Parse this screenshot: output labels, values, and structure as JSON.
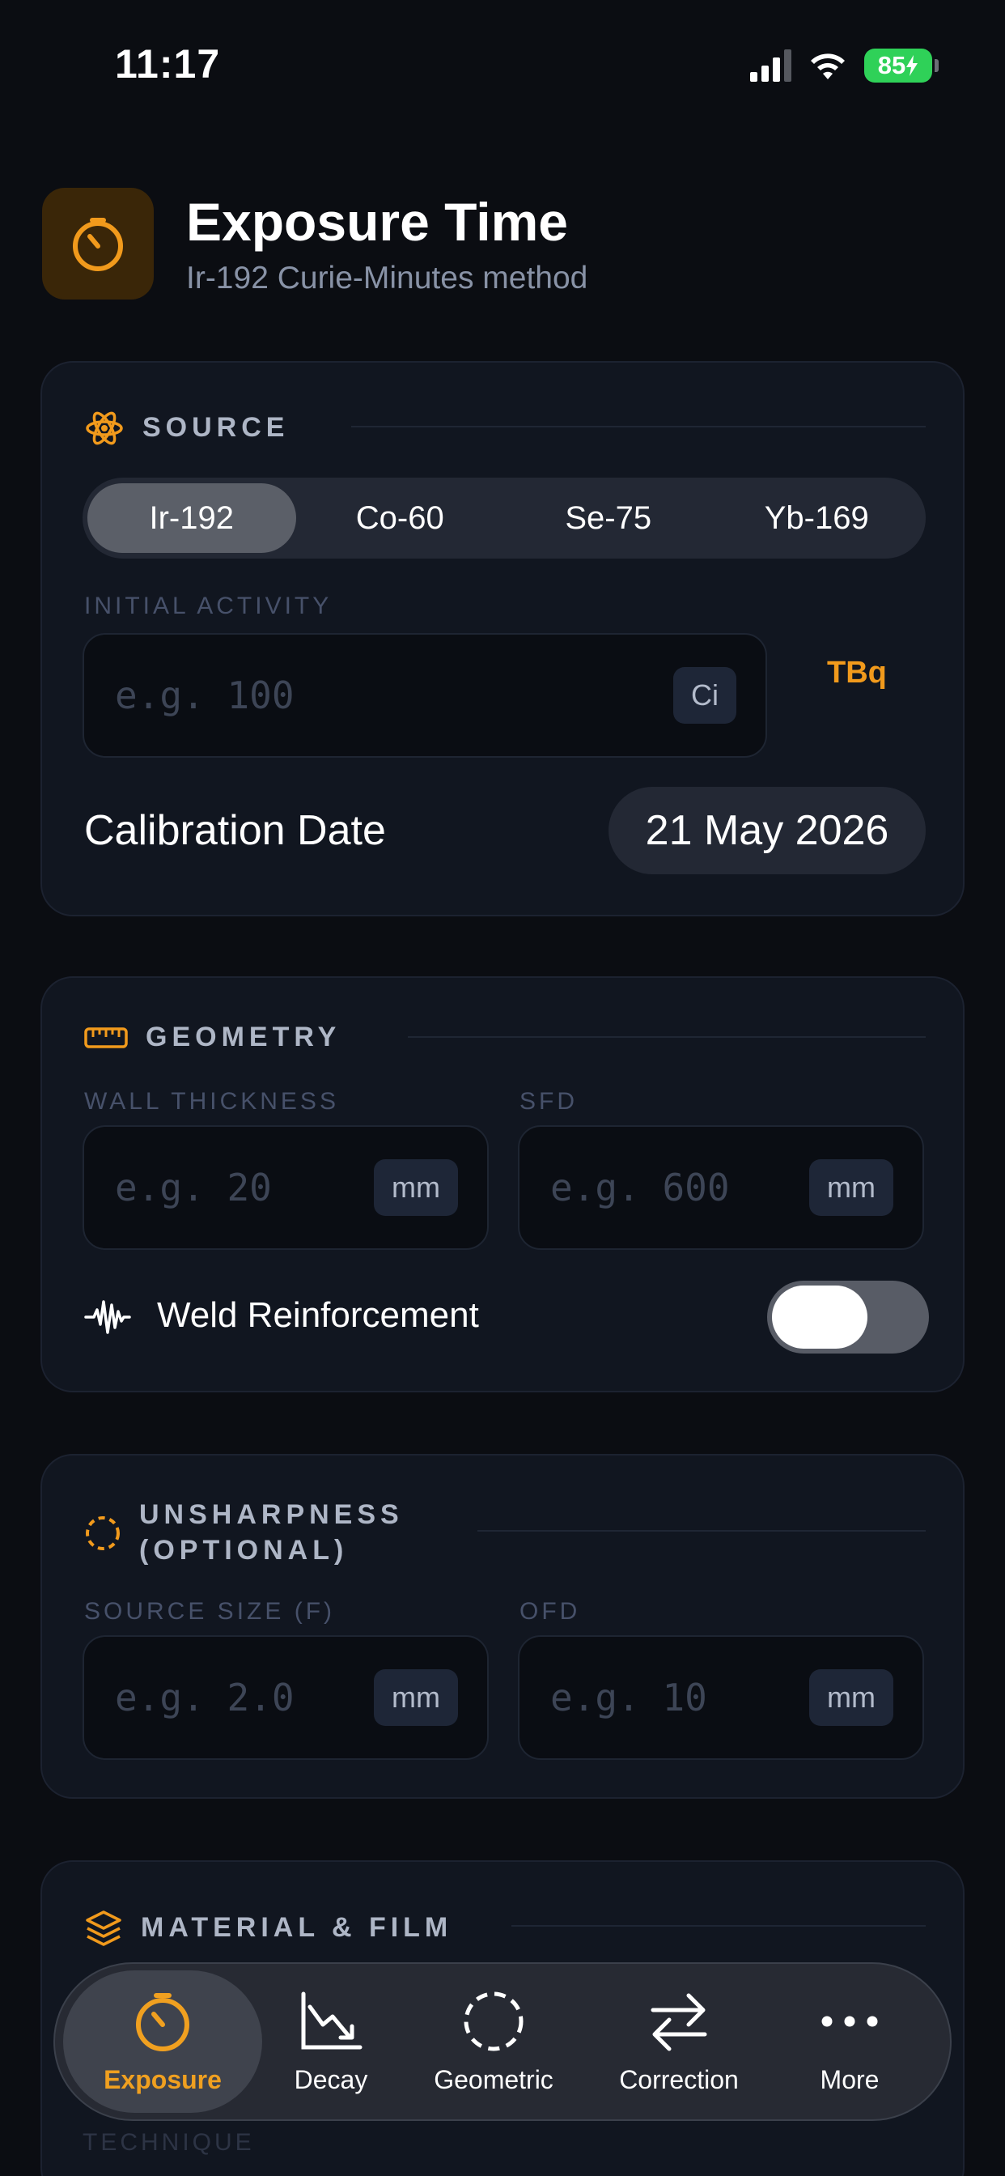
{
  "status_bar": {
    "time": "11:17",
    "battery": "85"
  },
  "header": {
    "title": "Exposure Time",
    "subtitle": "Ir-192 Curie-Minutes method"
  },
  "source": {
    "label": "SOURCE",
    "isotopes": [
      "Ir-192",
      "Co-60",
      "Se-75",
      "Yb-169"
    ],
    "selected": "Ir-192",
    "initial_activity_label": "INITIAL ACTIVITY",
    "initial_activity_placeholder": "e.g. 100",
    "unit": "Ci",
    "alt_unit": "TBq",
    "calibration_label": "Calibration Date",
    "calibration_date": "21 May 2026"
  },
  "geometry": {
    "label": "GEOMETRY",
    "wall_label": "WALL THICKNESS",
    "wall_placeholder": "e.g. 20",
    "wall_unit": "mm",
    "sfd_label": "SFD",
    "sfd_placeholder": "e.g. 600",
    "sfd_unit": "mm",
    "weld_label": "Weld Reinforcement",
    "weld_on": false
  },
  "unsharpness": {
    "label_line1": "UNSHARPNESS",
    "label_line2": "(OPTIONAL)",
    "source_size_label": "SOURCE SIZE (F)",
    "source_size_placeholder": "e.g. 2.0",
    "source_size_unit": "mm",
    "ofd_label": "OFD",
    "ofd_placeholder": "e.g. 10",
    "ofd_unit": "mm"
  },
  "material": {
    "label": "MATERIAL & FILM",
    "technique_label": "TECHNIQUE"
  },
  "tabbar": {
    "items": [
      {
        "label": "Exposure",
        "icon": "timer-icon"
      },
      {
        "label": "Decay",
        "icon": "decay-chart-icon"
      },
      {
        "label": "Geometric",
        "icon": "dashed-circle-icon"
      },
      {
        "label": "Correction",
        "icon": "arrows-swap-icon"
      },
      {
        "label": "More",
        "icon": "ellipsis-icon"
      }
    ],
    "active": "Exposure"
  },
  "colors": {
    "accent": "#f19a1c",
    "background": "#0b0d12",
    "card": "#111620"
  }
}
